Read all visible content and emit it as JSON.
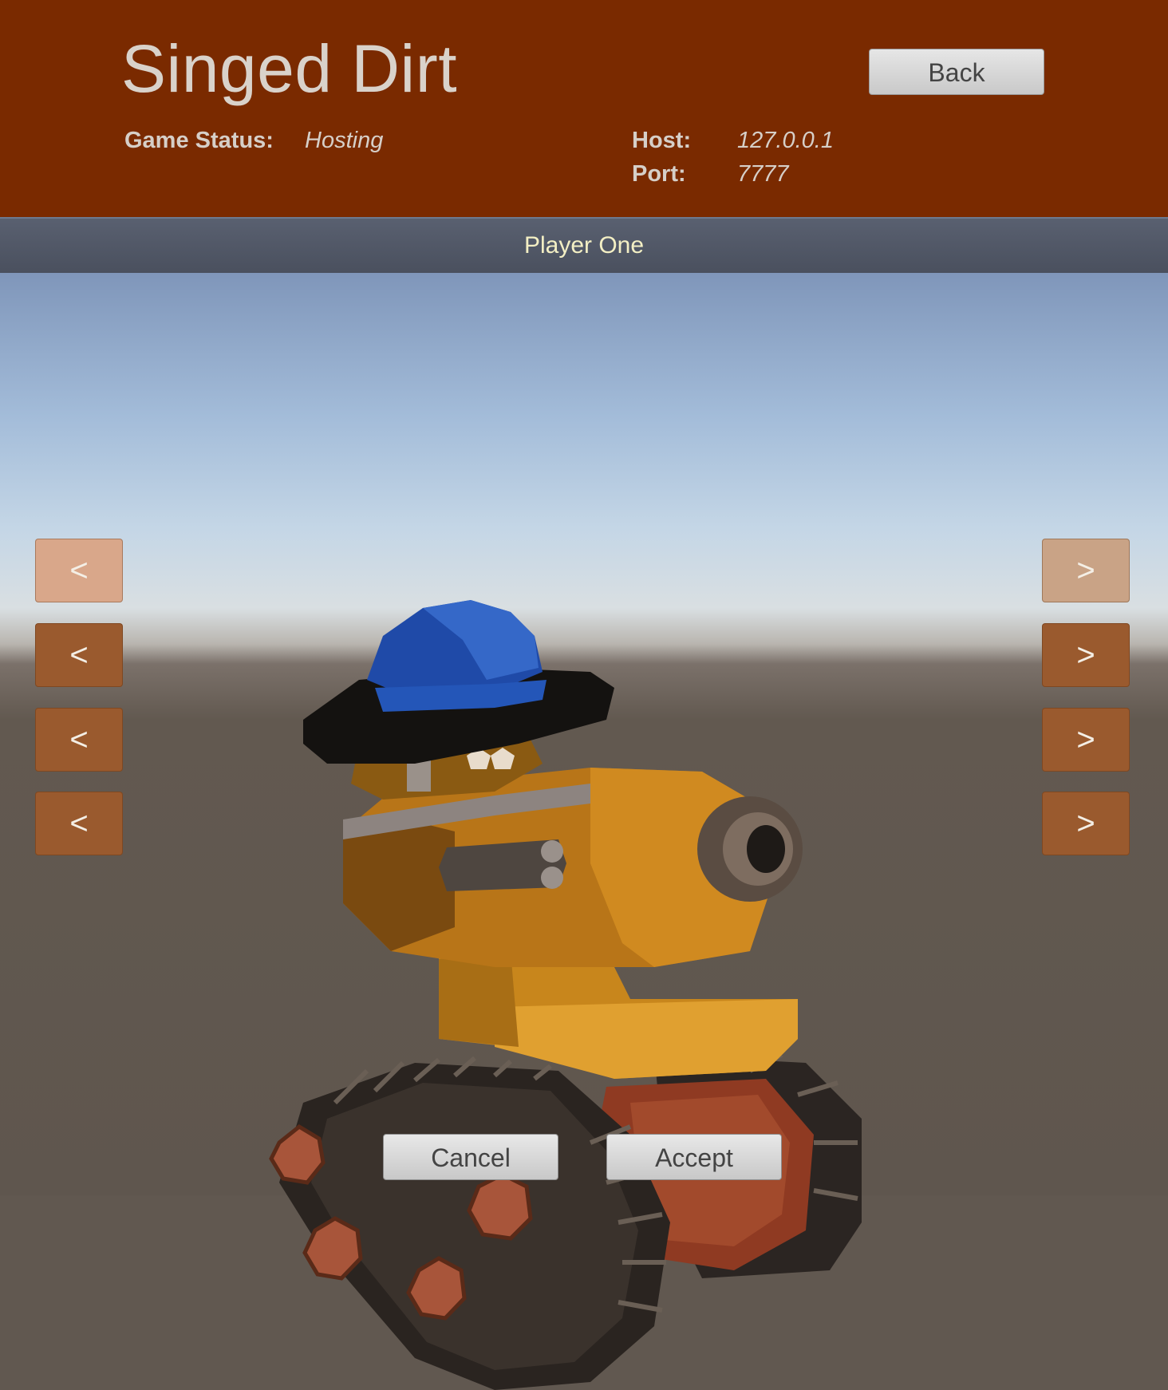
{
  "header": {
    "title": "Singed Dirt",
    "back_label": "Back",
    "game_status_label": "Game Status:",
    "game_status_value": "Hosting",
    "host_label": "Host:",
    "host_value": "127.0.0.1",
    "port_label": "Port:",
    "port_value": "7777"
  },
  "player": {
    "name": "Player One"
  },
  "selectors": {
    "left_symbol": "<",
    "right_symbol": ">"
  },
  "footer": {
    "cancel_label": "Cancel",
    "accept_label": "Accept"
  },
  "colors": {
    "header_bg": "#7a2a00",
    "player_bar_bg": "#50576a",
    "player_name_text": "#f3efc4",
    "arrow_button": "#9a5a2e",
    "arrow_button_highlight": "#d9a78a"
  }
}
